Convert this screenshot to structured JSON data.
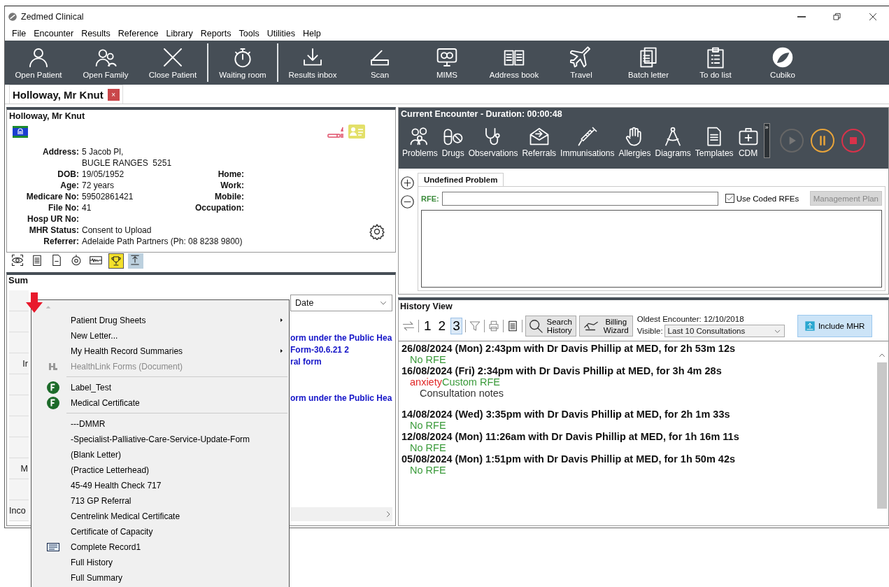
{
  "window": {
    "title": "Zedmed Clinical"
  },
  "menu_bar": [
    "File",
    "Encounter",
    "Results",
    "Reference",
    "Library",
    "Reports",
    "Tools",
    "Utilities",
    "Help"
  ],
  "toolbar_groups": [
    [
      "Open Patient",
      "Open Family",
      "Close Patient"
    ],
    [
      "Waiting room"
    ],
    [
      "Results inbox",
      "Scan",
      "MIMS",
      "Address book",
      "Travel",
      "Batch letter",
      "To do list",
      "Cubiko"
    ]
  ],
  "patient_tabs": [
    {
      "label": "Holloway, Mr Knut",
      "selected": true,
      "close": "×"
    }
  ],
  "patient": {
    "name": "Holloway, Mr Knut",
    "rows": [
      {
        "label": "Address:",
        "value": "5 Jacob Pl,"
      },
      {
        "value": "BUGLE RANGES  5251"
      },
      {
        "label": "DOB:",
        "value": "19/05/1952",
        "contact_label": "Home:"
      },
      {
        "label": "Age:",
        "value": "72 years",
        "contact_label": "Work:"
      },
      {
        "label": "Medicare No:",
        "value": "59502861421",
        "contact_label": "Mobile:"
      },
      {
        "label": "File No:",
        "value": "41",
        "contact_label": "Occupation:"
      },
      {
        "label": "Hosp UR No:"
      },
      {
        "label": "MHR Status:",
        "value": "Consent to Upload"
      },
      {
        "label": "Referrer:",
        "value": "Adelaide Path Partners (Ph: 08 8238 9800)"
      }
    ]
  },
  "summary": {
    "title": "Sum",
    "left_cells": [
      "Ir",
      "M",
      "Inco"
    ],
    "sort": "Date",
    "documents": [
      [
        "orm under the Public Hea",
        "Form-30.6.21 2",
        "ral form"
      ],
      [
        "orm under the Public Hea"
      ]
    ]
  },
  "context_menu": [
    {
      "kind": "submenu",
      "label": "Patient Drug Sheets",
      "disabled": false
    },
    {
      "kind": "plain",
      "label": "New Letter...",
      "disabled": false
    },
    {
      "kind": "submenu",
      "label": "My Health Record Summaries",
      "disabled": false
    },
    {
      "kind": "healthlink",
      "label": "HealthLink Forms (Document)",
      "disabled": true
    },
    {
      "kind": "separator"
    },
    {
      "kind": "fillable",
      "label": "Label_Test",
      "disabled": false
    },
    {
      "kind": "fillable",
      "label": "Medical Certificate",
      "disabled": false
    },
    {
      "kind": "separator"
    },
    {
      "kind": "plain",
      "label": "---DMMR",
      "disabled": false
    },
    {
      "kind": "plain",
      "label": "-Specialist-Palliative-Care-Service-Update-Form",
      "disabled": false
    },
    {
      "kind": "plain",
      "label": "(Blank Letter)",
      "disabled": false
    },
    {
      "kind": "plain",
      "label": "(Practice Letterhead)",
      "disabled": false
    },
    {
      "kind": "plain",
      "label": "45-49 Health Check 717",
      "disabled": false
    },
    {
      "kind": "plain",
      "label": "713 GP Referral",
      "disabled": false
    },
    {
      "kind": "plain",
      "label": "Centrelink Medical Certificate",
      "disabled": false
    },
    {
      "kind": "plain",
      "label": "Certificate of Capacity",
      "disabled": false
    },
    {
      "kind": "form",
      "label": "Complete Record1",
      "disabled": false
    },
    {
      "kind": "plain",
      "label": "Full History",
      "disabled": false
    },
    {
      "kind": "plain",
      "label": "Full Summary",
      "disabled": false
    }
  ],
  "encounter": {
    "title": "Current Encounter - Duration: 00:00:48",
    "tools": [
      "Problems",
      "Drugs",
      "Observations",
      "Referrals",
      "Immunisations",
      "Allergies",
      "Diagrams",
      "Templates",
      "CDM"
    ],
    "overflow": "»",
    "controls": [
      {
        "kind": "play",
        "disabled": true
      },
      {
        "kind": "pause",
        "disabled": false
      },
      {
        "kind": "stop",
        "disabled": false
      }
    ],
    "problem_tabs": [
      {
        "label": "Undefined Problem",
        "selected": true
      }
    ],
    "rfe_label": "RFE:",
    "use_coded_rfes": {
      "label": "Use Coded RFEs",
      "checked": true
    },
    "management_plan": {
      "label": "Management Plan",
      "disabled": true
    }
  },
  "history": {
    "title": "History View",
    "pages": [
      {
        "label": "1",
        "selected": false
      },
      {
        "label": "2",
        "selected": false
      },
      {
        "label": "3",
        "selected": true
      }
    ],
    "search_button": "Search History",
    "billing_button": "Billing Wizard",
    "oldest_encounter": "Oldest Encounter: 12/10/2018",
    "visible_label": "Visible:",
    "visible_value": "Last 10 Consultations",
    "include_mhr": "Include MHR",
    "entries": [
      {
        "heading": "26/08/2024 (Mon) 2:43pm with Dr Davis Phillip at MED, for 2h 53m 12s",
        "rfe": [
          {
            "kind": "rfe",
            "text": "No RFE"
          }
        ]
      },
      {
        "heading": "16/08/2024 (Fri) 2:34pm with Dr Davis Phillip at MED, for 3h 4m 28s",
        "rfe": [
          {
            "kind": "problem",
            "text": "anxiety"
          },
          {
            "kind": "rfe",
            "text": "Custom RFE"
          }
        ],
        "notes": "Consultation notes"
      },
      {
        "heading": "14/08/2024 (Wed) 3:35pm with Dr Davis Phillip at MED, for 2h 1m 33s",
        "rfe": [
          {
            "kind": "rfe",
            "text": "No RFE"
          }
        ]
      },
      {
        "heading": "12/08/2024 (Mon) 11:26am with Dr Davis Phillip at MED, for 1h 16m 11s",
        "rfe": [
          {
            "kind": "rfe",
            "text": "No RFE"
          }
        ]
      },
      {
        "heading": "05/08/2024 (Mon) 1:51pm with Dr Davis Phillip at MED, for 1h 50m 42s",
        "rfe": [
          {
            "kind": "rfe",
            "text": "No RFE"
          }
        ]
      }
    ]
  }
}
